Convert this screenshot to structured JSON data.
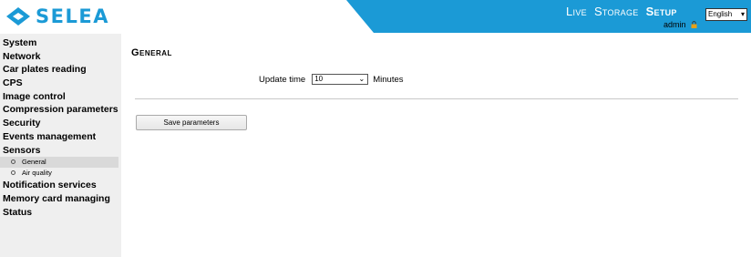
{
  "header": {
    "logo_text": "SELEA",
    "nav": [
      "Live",
      "Storage",
      "Setup"
    ],
    "active_nav": "Setup",
    "language": "English",
    "user": "admin",
    "accent": "#1b9ad6"
  },
  "sidebar": {
    "items": [
      {
        "label": "System"
      },
      {
        "label": "Network"
      },
      {
        "label": "Car plates reading"
      },
      {
        "label": "CPS"
      },
      {
        "label": "Image control"
      },
      {
        "label": "Compression parameters"
      },
      {
        "label": "Security"
      },
      {
        "label": "Events management"
      },
      {
        "label": "Sensors"
      }
    ],
    "sub_items": [
      {
        "label": "General",
        "selected": true
      },
      {
        "label": "Air quality",
        "selected": false
      }
    ],
    "items_after": [
      {
        "label": "Notification services"
      },
      {
        "label": "Memory card managing"
      },
      {
        "label": "Status"
      }
    ]
  },
  "main": {
    "title": "General",
    "update_time_label": "Update time",
    "update_time_value": "10",
    "unit": "Minutes",
    "save_label": "Save parameters"
  }
}
